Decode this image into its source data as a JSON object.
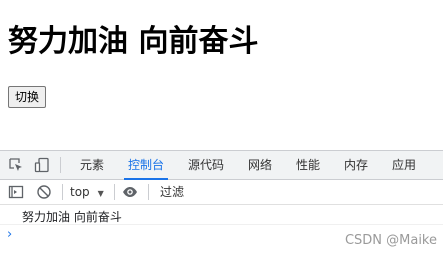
{
  "page": {
    "heading": "努力加油 向前奋斗",
    "toggle_button": "切换"
  },
  "devtools": {
    "tabs": [
      {
        "label": "元素"
      },
      {
        "label": "控制台"
      },
      {
        "label": "源代码"
      },
      {
        "label": "网络"
      },
      {
        "label": "性能"
      },
      {
        "label": "内存"
      },
      {
        "label": "应用"
      }
    ],
    "active_tab": "控制台",
    "context_select": "top",
    "filter_placeholder": "过滤",
    "console_output": "努力加油   向前奋斗",
    "prompt_symbol": "›"
  },
  "watermark": "CSDN @Maike",
  "colors": {
    "accent": "#1a73e8",
    "tab_bar_bg": "#f1f3f4",
    "border": "#cbcdd1"
  }
}
